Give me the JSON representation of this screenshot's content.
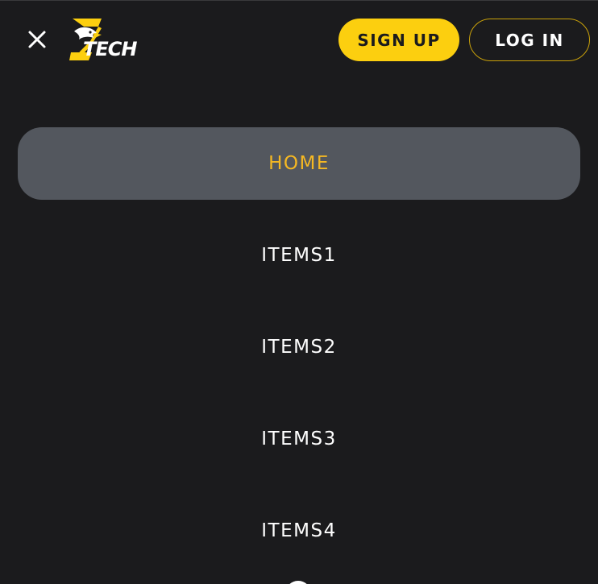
{
  "header": {
    "close_icon": "close-icon",
    "logo": {
      "word": "TECH",
      "mark_letter": "Z",
      "icon": "eagle-logo-icon"
    },
    "signup_label": "SIGN UP",
    "login_label": "LOG IN"
  },
  "menu": {
    "items": [
      {
        "label": "HOME",
        "active": true
      },
      {
        "label": "ITEMS1",
        "active": false
      },
      {
        "label": "ITEMS2",
        "active": false
      },
      {
        "label": "ITEMS3",
        "active": false
      },
      {
        "label": "ITEMS4",
        "active": false
      }
    ]
  },
  "colors": {
    "background": "#1b1b1d",
    "accent": "#fccf0f",
    "active_text": "#f5b823",
    "active_bg": "#53575e",
    "text": "#ffffff"
  }
}
